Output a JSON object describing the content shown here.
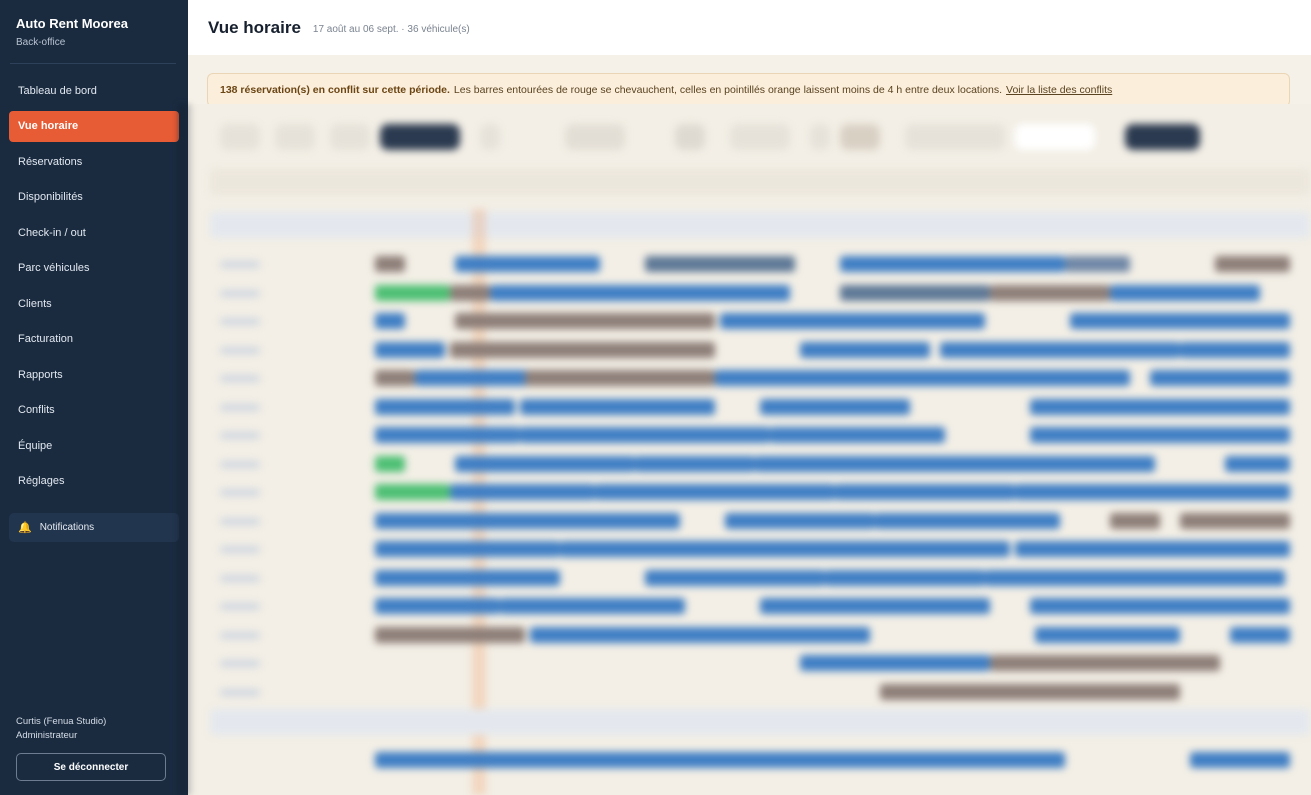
{
  "brand": {
    "title": "Auto Rent Moorea",
    "subtitle": "Back-office"
  },
  "nav": {
    "items": [
      {
        "label": "Tableau de bord"
      },
      {
        "label": "Vue horaire",
        "active": true
      },
      {
        "label": "Réservations"
      },
      {
        "label": "Disponibilités"
      },
      {
        "label": "Check-in / out"
      },
      {
        "label": "Parc véhicules"
      },
      {
        "label": "Clients"
      },
      {
        "label": "Facturation"
      },
      {
        "label": "Rapports"
      },
      {
        "label": "Conflits"
      },
      {
        "label": "Équipe"
      },
      {
        "label": "Réglages"
      }
    ],
    "notifications": {
      "label": "Notifications",
      "icon": "bell-icon"
    }
  },
  "user": {
    "name": "Curtis (Fenua Studio)",
    "role": "Administrateur",
    "logout_label": "Se déconnecter"
  },
  "header": {
    "title": "Vue horaire",
    "subtitle": "17 août au 06 sept. · 36 véhicule(s)"
  },
  "alert": {
    "strong": "138 réservation(s) en conflit sur cette période.",
    "text": "Les barres entourées de rouge se chevauchent, celles en pointillés orange laissent moins de 4 h entre deux locations.",
    "link": "Voir la liste des conflits"
  },
  "colors": {
    "sidebar_bg": "#1a2b40",
    "accent": "#e85c35",
    "booking_blue": "#3f7ec4",
    "booking_green": "#4cbf73",
    "booking_gray": "#8d7e78",
    "alert_bg": "#fbeedb"
  }
}
